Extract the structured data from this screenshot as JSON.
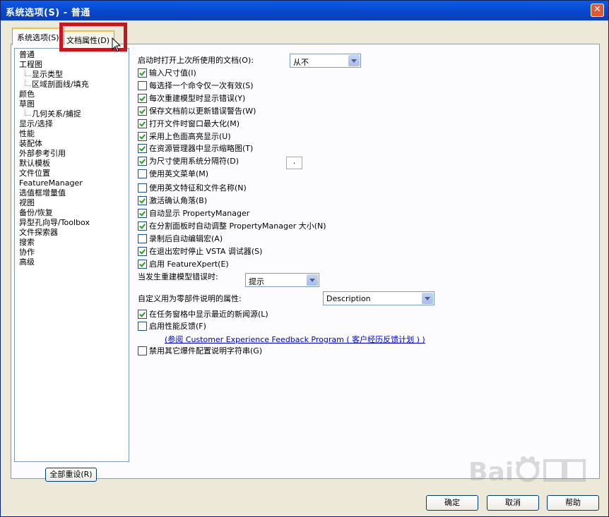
{
  "window": {
    "title": "系统选项(S) - 普通",
    "close_symbol": "✕"
  },
  "tabs": [
    {
      "label": "系统选项(S)",
      "active": true
    },
    {
      "label": "文档属性(D)",
      "active": false
    }
  ],
  "tree": [
    {
      "label": "普通",
      "level": 0,
      "selected": true
    },
    {
      "label": "工程图",
      "level": 0
    },
    {
      "label": "显示类型",
      "level": 1
    },
    {
      "label": "区域剖面线/填充",
      "level": 1
    },
    {
      "label": "颜色",
      "level": 0
    },
    {
      "label": "草图",
      "level": 0
    },
    {
      "label": "几何关系/捕捉",
      "level": 1
    },
    {
      "label": "显示/选择",
      "level": 0
    },
    {
      "label": "性能",
      "level": 0
    },
    {
      "label": "装配体",
      "level": 0
    },
    {
      "label": "外部参考引用",
      "level": 0
    },
    {
      "label": "默认模板",
      "level": 0
    },
    {
      "label": "文件位置",
      "level": 0
    },
    {
      "label": "FeatureManager",
      "level": 0
    },
    {
      "label": "选值框增量值",
      "level": 0
    },
    {
      "label": "视图",
      "level": 0
    },
    {
      "label": "备份/恢复",
      "level": 0
    },
    {
      "label": "异型孔向导/Toolbox",
      "level": 0
    },
    {
      "label": "文件探索器",
      "level": 0
    },
    {
      "label": "搜索",
      "level": 0
    },
    {
      "label": "协作",
      "level": 0
    },
    {
      "label": "高级",
      "level": 0
    }
  ],
  "reset_button": "全部重设(R)",
  "open_last_docs": {
    "label": "启动时打开上次所使用的文档(O):",
    "value": "从不"
  },
  "options_a": [
    {
      "label": "输入尺寸值(I)",
      "checked": true
    },
    {
      "label": "每选择一个命令仅一次有效(S)",
      "checked": false
    },
    {
      "label": "每次重建模型时显示错误(Y)",
      "checked": true
    },
    {
      "label": "保存文档前以更新错误警告(W)",
      "checked": true
    },
    {
      "label": "打开文件时窗口最大化(M)",
      "checked": true
    },
    {
      "label": "采用上色面高亮显示(U)",
      "checked": true
    },
    {
      "label": "在资源管理器中显示缩略图(T)",
      "checked": true
    },
    {
      "label": "为尺寸使用系统分隔符(D)",
      "checked": true
    },
    {
      "label": "使用英文菜单(M)",
      "checked": false
    },
    {
      "label": "使用英文特征和文件名称(N)",
      "checked": false
    },
    {
      "label": "激活确认角落(B)",
      "checked": true
    },
    {
      "label": "自动显示 PropertyManager",
      "checked": true
    },
    {
      "label": "在分割面板时自动调整 PropertyManager 大小(N)",
      "checked": true
    },
    {
      "label": "录制后自动编辑宏(A)",
      "checked": false
    },
    {
      "label": "在退出宏时停止 VSTA 调试器(S)",
      "checked": true
    },
    {
      "label": "启用 FeatureXpert(E)",
      "checked": true
    }
  ],
  "separator_value": ".",
  "rebuild_error": {
    "label": "当发生重建模型错误时:",
    "value": "提示"
  },
  "custom_property": {
    "label": "自定义用为零部件说明的属性:",
    "value": "Description"
  },
  "options_b": [
    {
      "label": "在任务窗格中显示最近的新闻源(L)",
      "checked": true
    },
    {
      "label": "启用性能反馈(F)",
      "checked": false
    }
  ],
  "feedback_link": "(参阅 Customer Experience Feedback Program ( 客户经历反馈计划 ) )",
  "option_c": {
    "label": "禁用其它爆件配置说明字符串(G)",
    "checked": false
  },
  "buttons": {
    "ok": "确定",
    "cancel": "取消",
    "help": "帮助"
  }
}
